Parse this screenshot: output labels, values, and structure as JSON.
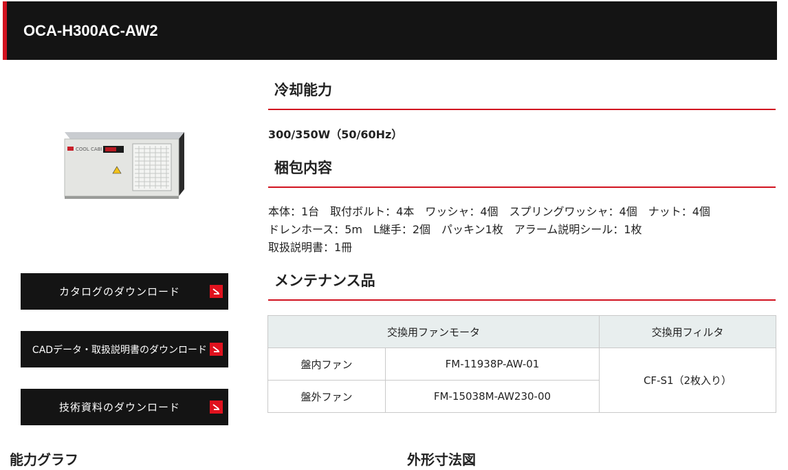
{
  "header": {
    "title": "OCA-H300AC-AW2"
  },
  "product": {
    "image_label": "COOL CABI",
    "buttons": [
      {
        "label": "カタログのダウンロード"
      },
      {
        "label": "CADデータ・取扱説明書のダウンロード"
      },
      {
        "label": "技術資料のダウンロード"
      }
    ]
  },
  "sections": {
    "cooling": {
      "title": "冷却能力",
      "value": "300/350W（50/60Hz）"
    },
    "package": {
      "title": "梱包内容",
      "lines": [
        "本体：1台　取付ボルト：4本　ワッシャ：4個　スプリングワッシャ：4個　ナット：4個",
        "ドレンホース：5m　L継手：2個　パッキン1枚　アラーム説明シール：1枚",
        "取扱説明書：1冊"
      ]
    },
    "maintenance": {
      "title": "メンテナンス品",
      "header_fan": "交換用ファンモータ",
      "header_filter": "交換用フィルタ",
      "rows": [
        {
          "name": "盤内ファン",
          "part": "FM-11938P-AW-01"
        },
        {
          "name": "盤外ファン",
          "part": "FM-15038M-AW230-00"
        }
      ],
      "filter": "CF-S1（2枚入り）"
    }
  },
  "bottom": {
    "graph_title": "能力グラフ",
    "dimension_title": "外形寸法図"
  },
  "colors": {
    "accent": "#d1121f",
    "dark": "#141414",
    "table_header": "#e8eeee"
  }
}
